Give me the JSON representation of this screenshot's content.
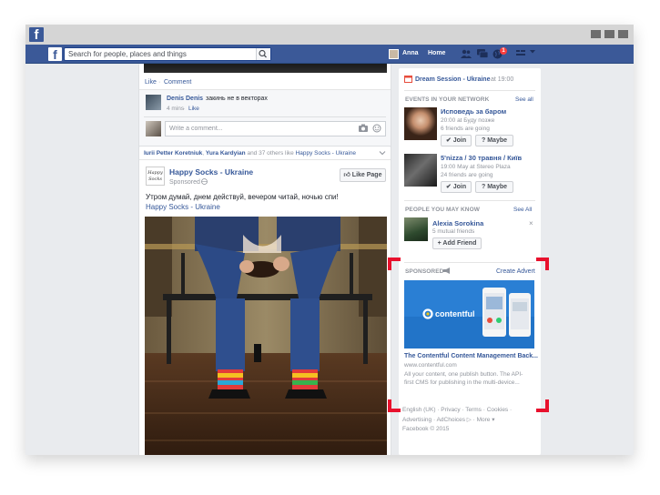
{
  "chrome": {
    "logo": "f"
  },
  "topbar": {
    "logo": "f",
    "search_placeholder": "Search for people, places and things",
    "user_name": "Anna",
    "home_label": "Home",
    "notification_count": "1"
  },
  "feed": {
    "prev_post": {
      "actions": {
        "like": "Like",
        "comment": "Comment"
      },
      "comment": {
        "author": "Denis Denis",
        "text": "закинь не в векторах",
        "time": "4 mins",
        "like": "Like"
      },
      "write_comment_placeholder": "Write a comment..."
    },
    "ad_post": {
      "social_context": {
        "friend1": "Iurii Petter Koretniuk",
        "friend2": "Yura Kardyian",
        "and_others": "and 37 others like",
        "page": "Happy Socks - Ukraine"
      },
      "page_name": "Happy Socks - Ukraine",
      "logo_text": "Happy Socks",
      "sponsored": "Sponsored",
      "like_page_button": "Like Page",
      "text": "Утром думай, днем действуй, вечером читай, ночью спи!",
      "link": "Happy Socks - Ukraine"
    }
  },
  "sidebar": {
    "dream_session": {
      "title": "Dream Session - Ukraine",
      "time": "at 19:00"
    },
    "events": {
      "heading": "EVENTS IN YOUR NETWORK",
      "see_all": "See all",
      "items": [
        {
          "title": "Исповедь за баром",
          "time": "20:00 at Буду позже",
          "friends": "6 friends are going",
          "join": "Join",
          "maybe": "Maybe"
        },
        {
          "title": "5'nizza / 30 травня / Київ",
          "time": "19:00 May at Stereo Plaza",
          "friends": "24 friends are going",
          "join": "Join",
          "maybe": "Maybe"
        }
      ]
    },
    "pymk": {
      "heading": "PEOPLE YOU MAY KNOW",
      "see_all": "See All",
      "name": "Alexia Sorokina",
      "mutual": "5 mutual friends",
      "add_friend": "Add Friend",
      "close": "×"
    },
    "sponsored": {
      "heading": "SPONSORED",
      "create_advert": "Create Advert",
      "brand": "contentful",
      "ad_title": "The Contentful Content Management Back...",
      "ad_url": "www.contentful.com",
      "ad_desc_1": "All your content, one publish button. The API-",
      "ad_desc_2": "first CMS for publishing in the multi-device..."
    },
    "footer": {
      "line1": "English (UK) · Privacy · Terms · Cookies ·",
      "line2": "Advertising · AdChoices ▷ · More ▾",
      "line3": "Facebook © 2015"
    }
  },
  "colors": {
    "facebook_blue": "#3b5998",
    "highlight_red": "#e8112d",
    "contentful_blue": "#2478cc"
  }
}
